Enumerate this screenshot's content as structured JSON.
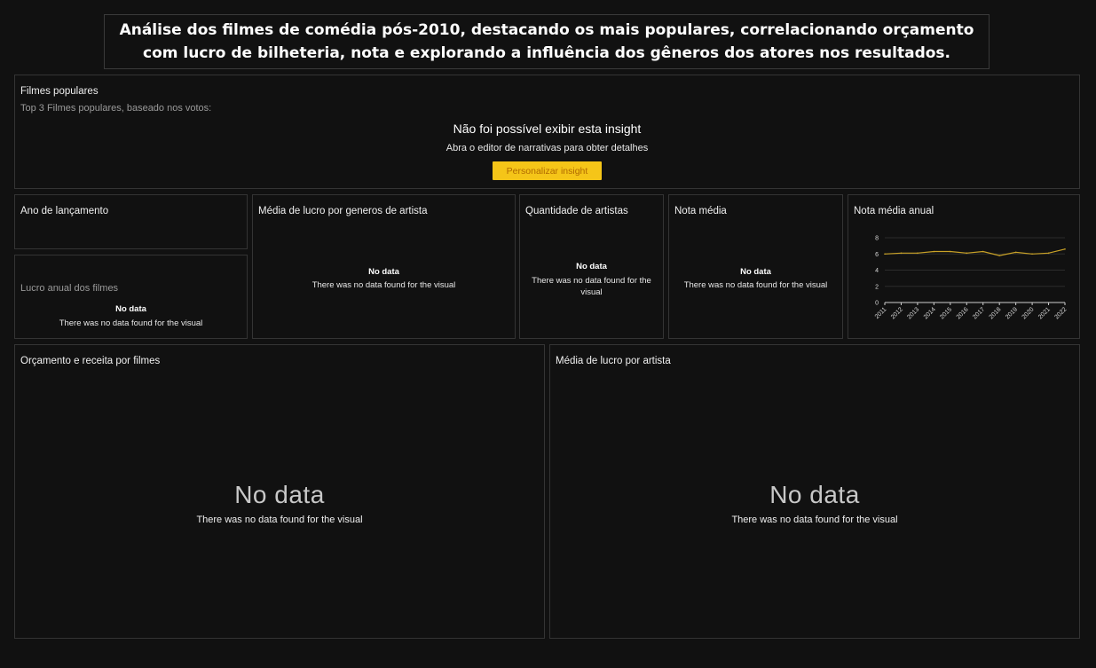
{
  "header": {
    "title": "Análise dos filmes de comédia pós-2010, destacando os mais populares, correlacionando orçamento com lucro de bilheteria, nota e explorando a influência dos gêneros dos atores nos resultados."
  },
  "no_data": {
    "title": "No data",
    "message": "There was no data found for the visual"
  },
  "panels": {
    "filmes_populares": {
      "title": "Filmes populares",
      "subtitle": "Top 3 Filmes populares, baseado nos votos:",
      "error_title": "Não foi possível exibir esta insight",
      "error_message": "Abra o editor de narrativas para obter detalhes",
      "button_label": "Personalizar insight"
    },
    "ano_lancamento": {
      "title": "Ano de lançamento"
    },
    "lucro_anual": {
      "title": "Lucro anual dos filmes"
    },
    "media_lucro_generos": {
      "title": "Média de lucro por generos de artista"
    },
    "quantidade_artistas": {
      "title": "Quantidade de artistas"
    },
    "nota_media": {
      "title": "Nota média"
    },
    "nota_media_anual": {
      "title": "Nota média anual"
    },
    "orcamento_receita": {
      "title": "Orçamento e receita por filmes"
    },
    "media_lucro_artista": {
      "title": "Média de lucro por artista"
    }
  },
  "colors": {
    "background": "#111111",
    "border": "#343434",
    "line": "#c9a227",
    "button": "#f5c518"
  },
  "chart_data": {
    "type": "line",
    "title": "Nota média anual",
    "x": [
      "2011",
      "2012",
      "2013",
      "2014",
      "2015",
      "2016",
      "2017",
      "2018",
      "2019",
      "2020",
      "2021",
      "2022"
    ],
    "series": [
      {
        "values": [
          6.0,
          6.1,
          6.1,
          6.3,
          6.3,
          6.1,
          6.3,
          5.8,
          6.2,
          6.0,
          6.1,
          6.6
        ]
      }
    ],
    "yticks": [
      0,
      2,
      4,
      6,
      8
    ],
    "ylim": [
      0,
      8
    ],
    "grid": true
  }
}
